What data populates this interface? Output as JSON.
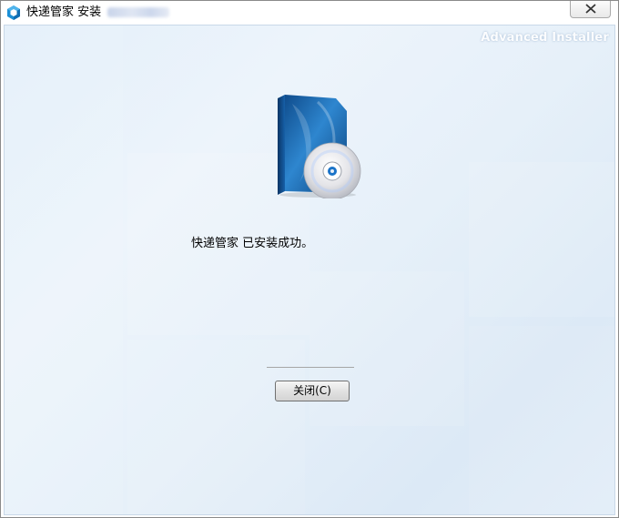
{
  "window": {
    "title": "快递管家 安装",
    "brand_watermark": "Advanced Installer"
  },
  "main": {
    "message": "快递管家 已安装成功。",
    "close_button_label": "关闭(C)"
  },
  "icons": {
    "app": "app-cube-icon",
    "close": "close-x-icon",
    "product": "software-box-cd-icon"
  },
  "colors": {
    "accent": "#1a73c8",
    "content_bg": "#e6f0f9"
  }
}
